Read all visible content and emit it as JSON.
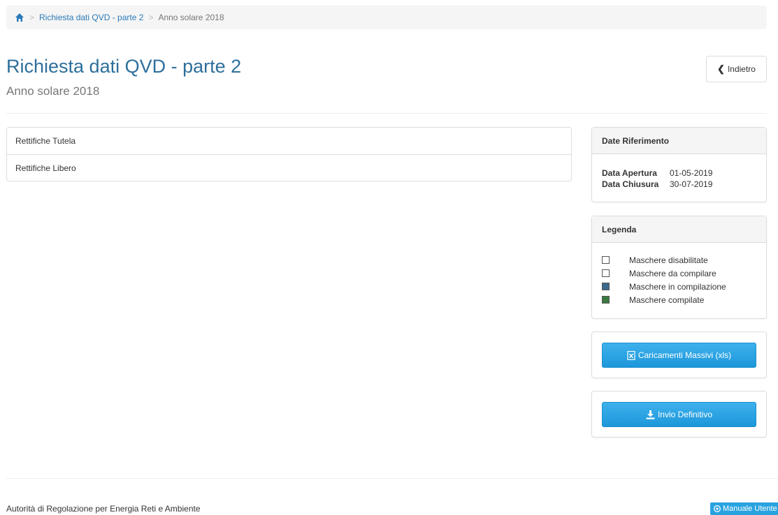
{
  "breadcrumb": {
    "home_icon": "home-icon",
    "items": [
      {
        "label": "Richiesta dati QVD - parte 2"
      },
      {
        "label": "Anno solare 2018"
      }
    ]
  },
  "header": {
    "title": "Richiesta dati QVD - parte 2",
    "subtitle": "Anno solare 2018",
    "back_icon": "chevron-left-icon",
    "back_label": "Indietro"
  },
  "sections": [
    {
      "label": "Rettifiche Tutela"
    },
    {
      "label": "Rettifiche Libero"
    }
  ],
  "dates_panel": {
    "title": "Date Riferimento",
    "rows": [
      {
        "label": "Data Apertura",
        "value": "01-05-2019"
      },
      {
        "label": "Data Chiusura",
        "value": "30-07-2019"
      }
    ]
  },
  "legend_panel": {
    "title": "Legenda",
    "items": [
      {
        "label": "Maschere disabilitate",
        "color": "#ffffff"
      },
      {
        "label": "Maschere da compilare",
        "color": "#ffffff"
      },
      {
        "label": "Maschere in compilazione",
        "color": "#3a6b8c"
      },
      {
        "label": "Maschere compilate",
        "color": "#3a7a3e"
      }
    ]
  },
  "actions": {
    "bulk_upload": {
      "label": "Caricamenti Massivi (xls)",
      "icon": "excel-file-icon"
    },
    "final_submit": {
      "label": "Invio Definitivo",
      "icon": "download-icon"
    }
  },
  "footer": {
    "text": "Autorità di Regolazione per Energia Reti e Ambiente",
    "manual_label": "Manuale Utente",
    "manual_icon": "help-circle-icon"
  },
  "colors": {
    "link": "#2a7ab8",
    "title": "#2d6f9c",
    "primary": "#29a3e0"
  }
}
